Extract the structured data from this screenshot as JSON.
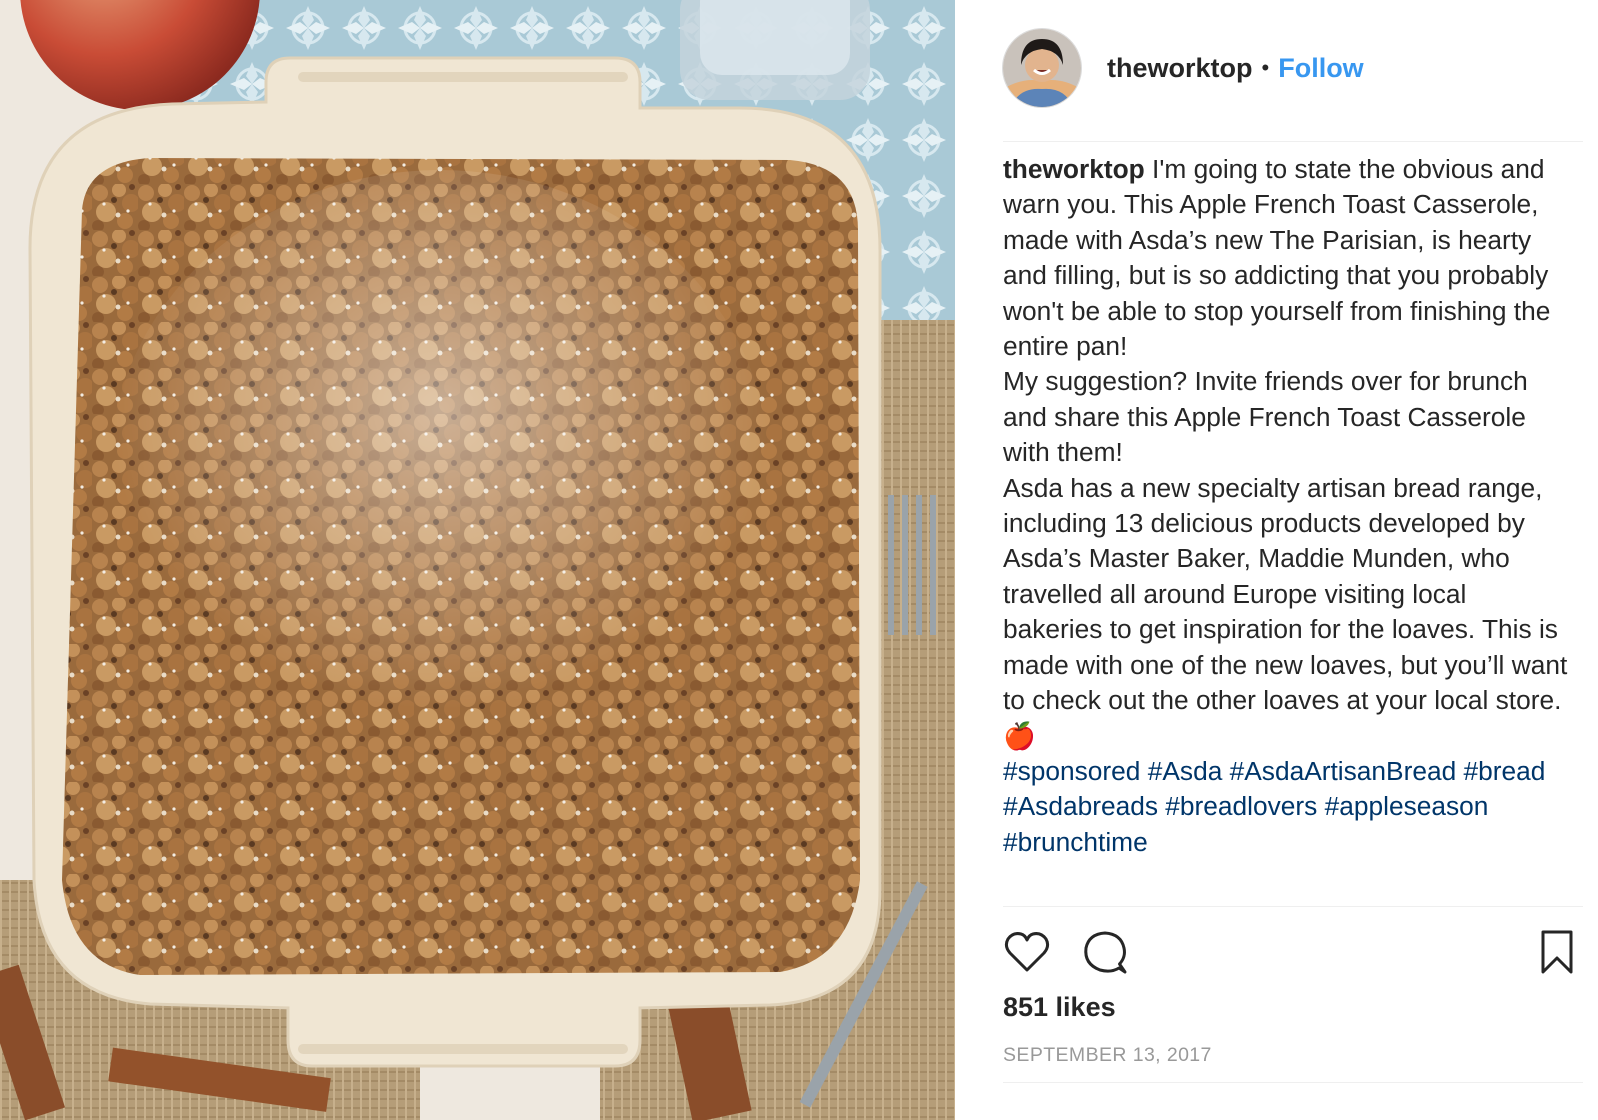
{
  "post": {
    "username": "theworktop",
    "separator": "•",
    "follow_label": "Follow",
    "caption": {
      "paragraphs": [
        "I'm going to state the obvious and warn you. This Apple French Toast Casserole, made with Asda’s new The Parisian, is hearty and filling, but is so addicting that you probably won't be able to stop yourself from finishing the entire pan!",
        "My suggestion? Invite friends over for brunch and share this Apple French Toast Casserole with them!",
        "Asda has a new specialty artisan bread range, including 13 delicious products developed by Asda’s Master Baker, Maddie Munden, who travelled all around Europe visiting local bakeries to get inspiration for the loaves. This is made with one of the new loaves, but you’ll want to check out the other loaves at your local store."
      ],
      "emoji": "🍎",
      "hashtags": [
        "#sponsored",
        "#Asda",
        "#AsdaArtisanBread",
        "#bread",
        "#Asdabreads",
        "#breadlovers",
        "#appleseason",
        "#brunchtime"
      ]
    },
    "likes": "851 likes",
    "date": "SEPTEMBER 13, 2017"
  },
  "icons": {
    "like": "heart-outline-icon",
    "comment": "speech-bubble-icon",
    "save": "bookmark-outline-icon"
  },
  "colors": {
    "link_blue": "#3897f0",
    "hashtag": "#003569",
    "text": "#262626",
    "muted": "#999999",
    "divider": "#efefef"
  }
}
